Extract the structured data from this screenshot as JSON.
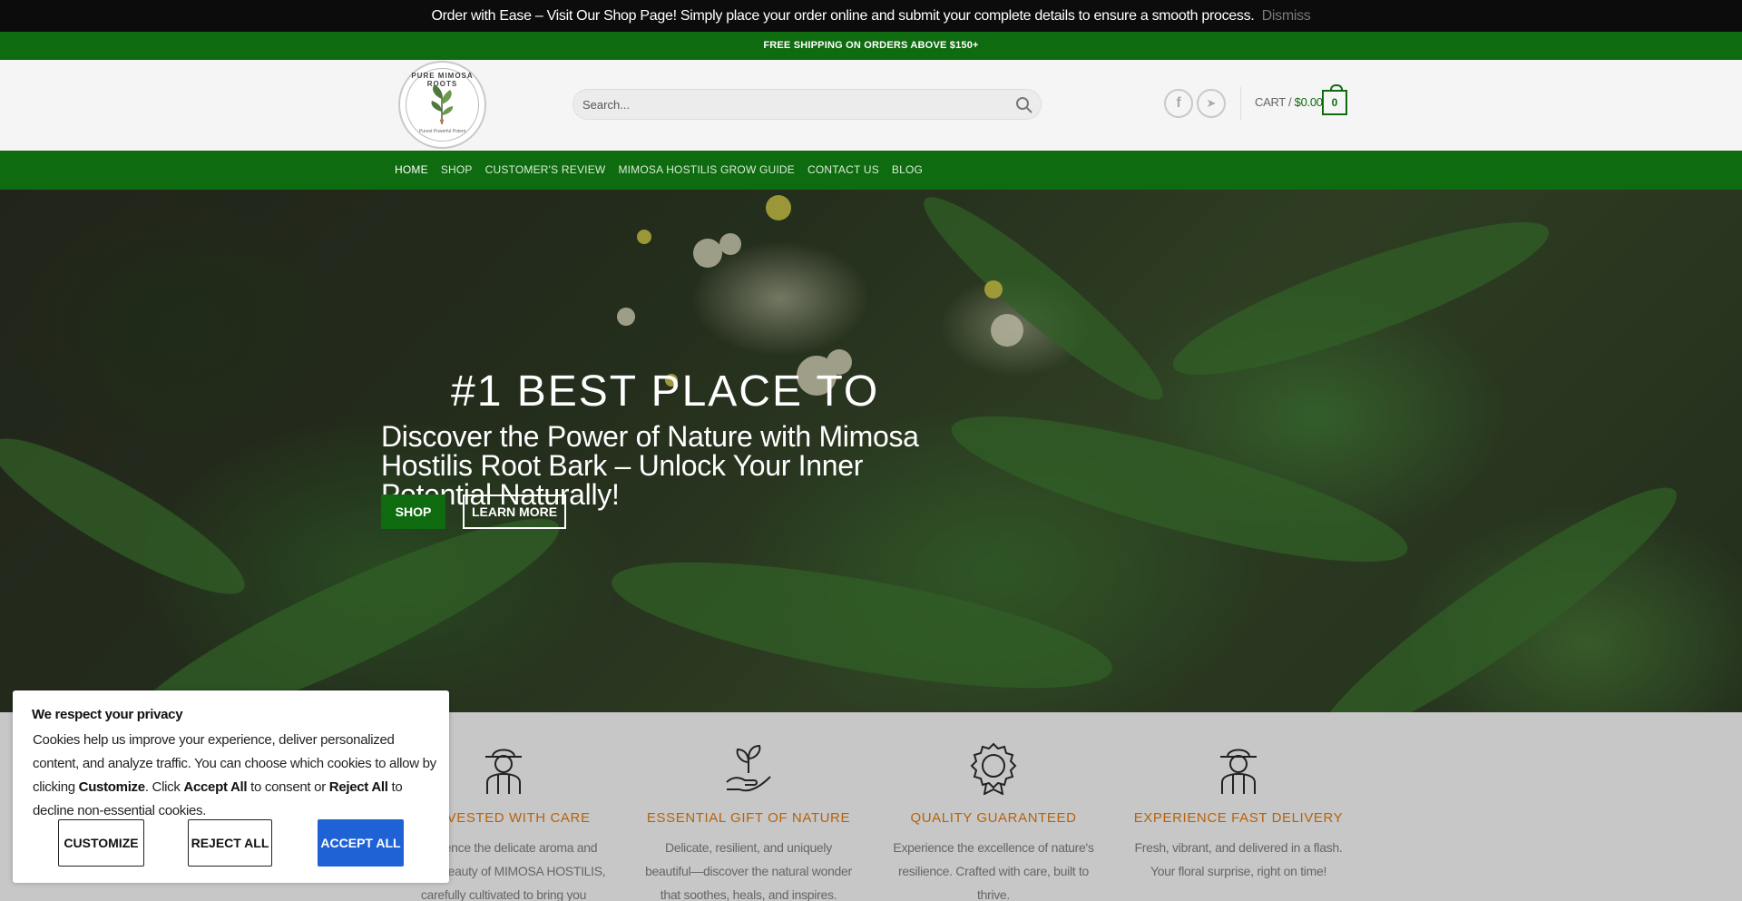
{
  "notice": {
    "text": "Order with Ease – Visit Our Shop Page! Simply place your order online and submit your complete details to ensure a smooth process.",
    "dismiss": "Dismiss"
  },
  "shipping": {
    "text": "FREE SHIPPING ON ORDERS ABOVE $150+"
  },
  "logo": {
    "top_text": "PURE MIMOSA ROOTS",
    "bottom_text": "Purest Powerful Potent"
  },
  "search": {
    "placeholder": "Search..."
  },
  "social": {
    "facebook_glyph": "f",
    "telegram_glyph": "➤"
  },
  "cart": {
    "label": "CART /",
    "amount": "$0.00",
    "count": "0"
  },
  "nav": {
    "items": [
      "HOME",
      "SHOP",
      "CUSTOMER'S REVIEW",
      "MIMOSA HOSTILIS GROW GUIDE",
      "CONTACT US",
      "BLOG"
    ]
  },
  "hero": {
    "kicker": "#1 BEST PLACE TO",
    "headline": "Discover the Power of Nature with Mimosa Hostilis Root Bark – Unlock Your Inner Potential Naturally!",
    "shop_button": "SHOP",
    "learn_button": "LEARN MORE"
  },
  "features": [
    {
      "title": "HARVESTED WITH CARE",
      "text": "Experience the delicate aroma and vibrant beauty of MIMOSA HOSTILIS, carefully cultivated to bring you nature's finest.",
      "icon": "farmer-icon"
    },
    {
      "title": "ESSENTIAL GIFT OF NATURE",
      "text": "Delicate, resilient, and uniquely beautiful—discover the natural wonder that soothes, heals, and inspires.",
      "icon": "hand-plant-icon"
    },
    {
      "title": "QUALITY GUARANTEED",
      "text": "Experience the excellence of nature's resilience. Crafted with care, built to thrive.",
      "icon": "quality-badge-icon"
    },
    {
      "title": "EXPERIENCE FAST DELIVERY",
      "text": "Fresh, vibrant, and delivered in a flash. Your floral surprise, right on time!",
      "icon": "farmer-icon"
    }
  ],
  "cookie": {
    "title": "We respect your privacy",
    "line1": "Cookies help us improve your experience, deliver personalized content, and analyze traffic. You can choose which cookies to allow by clicking ",
    "customize_word": "Customize",
    "line2": ". Click ",
    "accept_word": "Accept All",
    "line3": " to consent or ",
    "reject_word": "Reject All",
    "line4": " to decline non-essential cookies.",
    "customize_button": "CUSTOMIZE",
    "reject_button": "REJECT ALL",
    "accept_button": "ACCEPT ALL"
  },
  "colors": {
    "brand_green": "#0f6b0f",
    "accent_orange": "#b8620a",
    "accept_blue": "#1e62d6"
  }
}
